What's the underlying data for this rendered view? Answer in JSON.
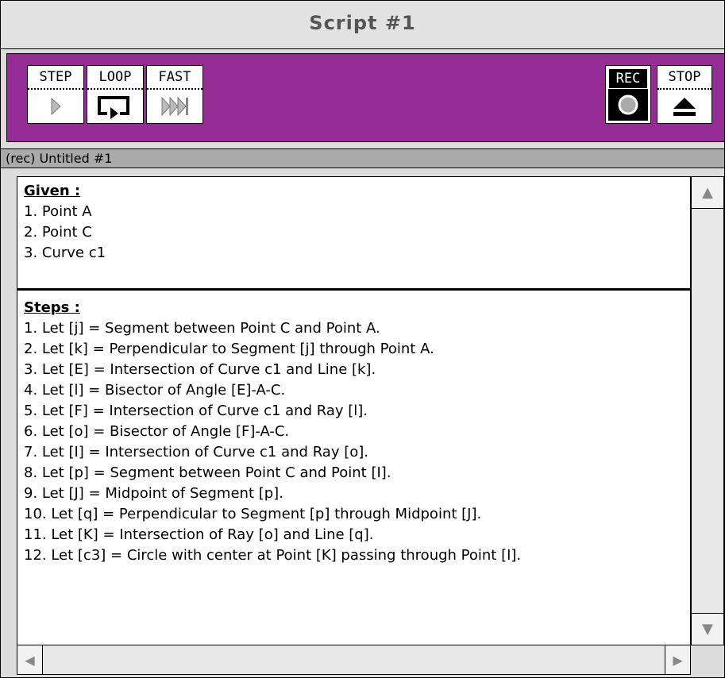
{
  "window": {
    "title": "Script #1"
  },
  "toolbar": {
    "step_label": "STEP",
    "loop_label": "LOOP",
    "fast_label": "FAST",
    "rec_label": "REC",
    "stop_label": "STOP",
    "background_color": "#952b95"
  },
  "status": {
    "text": "(rec) Untitled #1"
  },
  "given": {
    "heading": "Given :",
    "items": [
      "1. Point A",
      "2. Point C",
      "3. Curve c1"
    ]
  },
  "steps": {
    "heading": "Steps :",
    "items": [
      "1. Let [j] = Segment between Point C and Point A.",
      "2. Let [k] = Perpendicular to Segment [j] through Point A.",
      "3. Let [E] = Intersection of Curve c1 and Line [k].",
      "4. Let [l] = Bisector of Angle [E]-A-C.",
      "5. Let [F] = Intersection of Curve c1 and Ray [l].",
      "6. Let [o] = Bisector of Angle [F]-A-C.",
      "7. Let [I] = Intersection of Curve c1 and Ray [o].",
      "8. Let [p] = Segment between Point C and Point [I].",
      "9. Let [J] = Midpoint of Segment [p].",
      "10. Let [q] = Perpendicular to Segment [p] through Midpoint [J].",
      "11. Let [K] = Intersection of Ray [o] and Line [q].",
      "12. Let [c3] = Circle with center at Point [K] passing through Point [I]."
    ]
  },
  "icons": {
    "step": "play-single-icon",
    "loop": "loop-icon",
    "fast": "fast-forward-icon",
    "rec": "record-icon",
    "stop": "eject-icon"
  }
}
